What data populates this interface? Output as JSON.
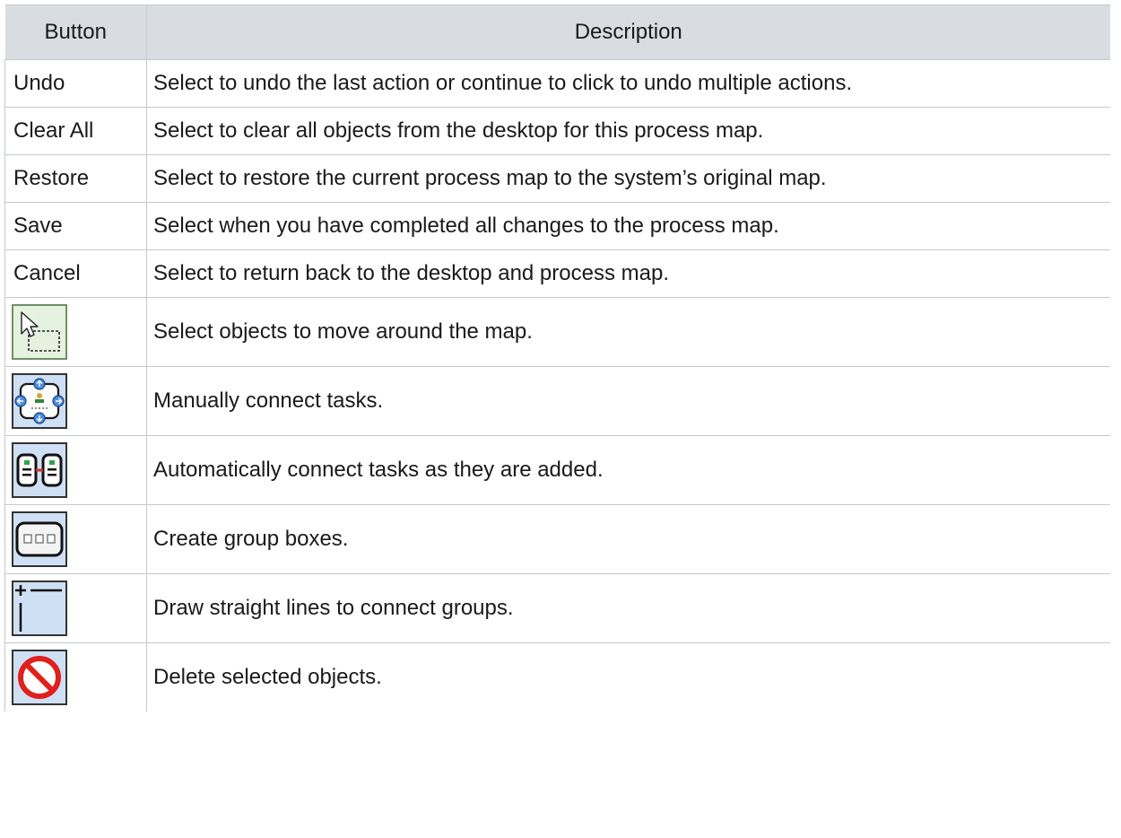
{
  "table": {
    "header": {
      "button": "Button",
      "description": "Description"
    },
    "text_rows": [
      {
        "button": "Undo",
        "description": "Select to undo the last action or continue to click to undo multiple actions."
      },
      {
        "button": "Clear All",
        "description": "Select to clear all objects from the desktop for this process map."
      },
      {
        "button": "Restore",
        "description": "Select to restore the current process map to the system’s original map."
      },
      {
        "button": "Save",
        "description": "Select when you have completed all changes to the process map."
      },
      {
        "button": "Cancel",
        "description": "Select to return back to the desktop and process map."
      }
    ],
    "icon_rows": [
      {
        "icon": "select-pointer-icon",
        "description": "Select objects to move around the map."
      },
      {
        "icon": "manual-connect-icon",
        "description": "Manually connect tasks."
      },
      {
        "icon": "auto-connect-icon",
        "description": "Automatically connect tasks as they are added."
      },
      {
        "icon": "group-box-icon",
        "description": "Create group boxes."
      },
      {
        "icon": "straight-line-icon",
        "description": "Draw straight lines to connect groups."
      },
      {
        "icon": "delete-icon",
        "description": "Delete selected objects."
      }
    ]
  }
}
